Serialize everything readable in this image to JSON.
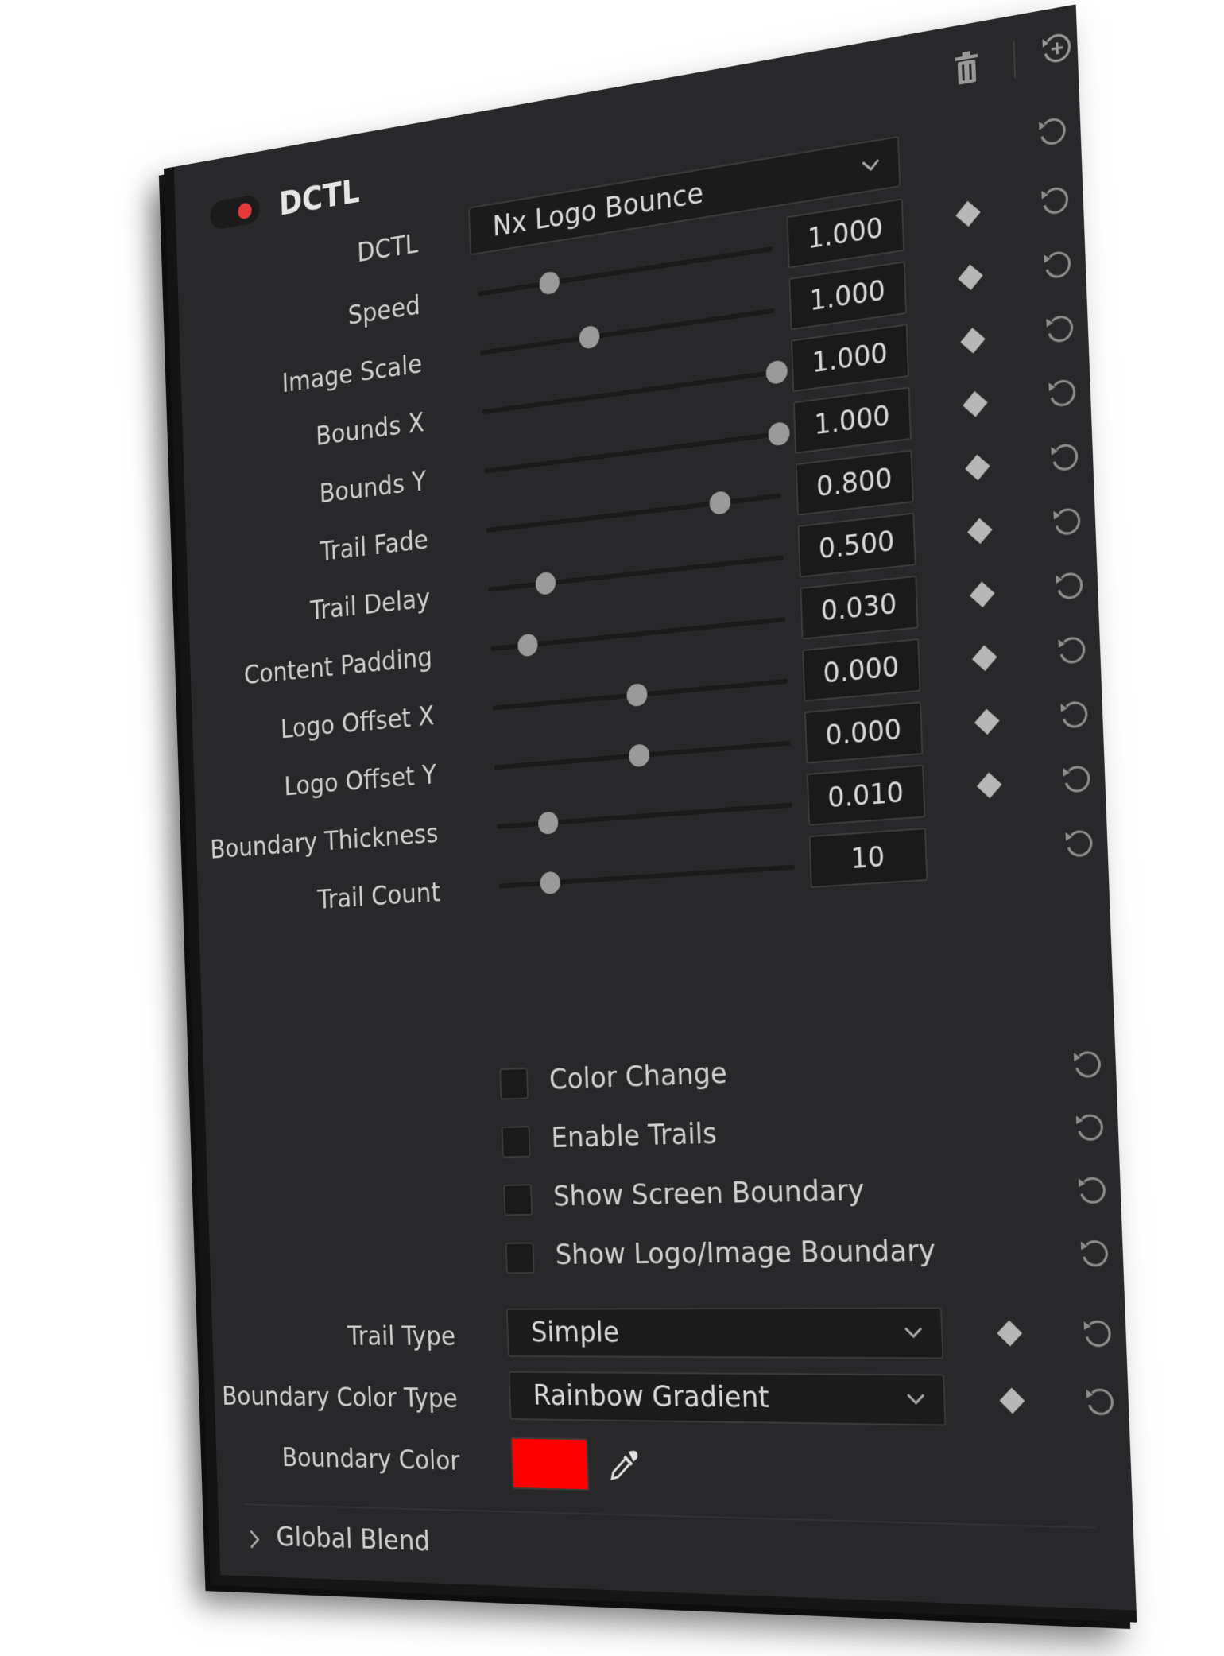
{
  "header": {
    "title": "DCTL",
    "enabled": true,
    "toggle_color": "#e8383a"
  },
  "toolbar": {
    "delete_icon": "trash-icon",
    "reset_all_icon": "add-reset-icon"
  },
  "dctl_select": {
    "label": "DCTL",
    "value": "Nx Logo Bounce"
  },
  "sliders": [
    {
      "label": "Speed",
      "value": "1.000",
      "position": 0.25
    },
    {
      "label": "Image Scale",
      "value": "1.000",
      "position": 0.38
    },
    {
      "label": "Bounds X",
      "value": "1.000",
      "position": 1.0
    },
    {
      "label": "Bounds Y",
      "value": "1.000",
      "position": 1.0
    },
    {
      "label": "Trail Fade",
      "value": "0.800",
      "position": 0.8
    },
    {
      "label": "Trail Delay",
      "value": "0.500",
      "position": 0.2
    },
    {
      "label": "Content Padding",
      "value": "0.030",
      "position": 0.13
    },
    {
      "label": "Logo Offset X",
      "value": "0.000",
      "position": 0.5
    },
    {
      "label": "Logo Offset Y",
      "value": "0.000",
      "position": 0.5
    },
    {
      "label": "Boundary Thickness",
      "value": "0.010",
      "position": 0.18
    },
    {
      "label": "Trail Count",
      "value": "10",
      "position": 0.18
    }
  ],
  "checkboxes": [
    {
      "label": "Color Change",
      "checked": false
    },
    {
      "label": "Enable Trails",
      "checked": false
    },
    {
      "label": "Show Screen Boundary",
      "checked": false
    },
    {
      "label": "Show Logo/Image Boundary",
      "checked": false
    }
  ],
  "trail_type": {
    "label": "Trail Type",
    "value": "Simple"
  },
  "boundary_color_type": {
    "label": "Boundary Color Type",
    "value": "Rainbow Gradient"
  },
  "boundary_color": {
    "label": "Boundary Color",
    "color": "#ff0000"
  },
  "global_blend": {
    "label": "Global Blend",
    "expanded": false
  }
}
